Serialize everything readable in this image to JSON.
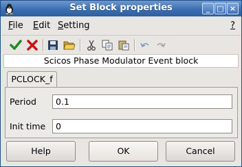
{
  "window": {
    "title": "Set Block properties"
  },
  "menu": {
    "file": {
      "mnemonic": "F",
      "rest": "ile"
    },
    "edit": {
      "mnemonic": "E",
      "rest": "dit"
    },
    "setting": {
      "mnemonic": "S",
      "rest": "etting"
    },
    "help": "?"
  },
  "toolbar": {
    "icons": [
      "check-icon",
      "cross-icon",
      "save-icon",
      "open-folder-icon",
      "cut-icon",
      "copy-icon",
      "paste-icon",
      "undo-icon",
      "redo-icon"
    ]
  },
  "block": {
    "title": "Scicos Phase Modulator Event block"
  },
  "tab": {
    "label": "PCLOCK_f"
  },
  "fields": {
    "period": {
      "label": "Period",
      "value": "0.1"
    },
    "init_time": {
      "label": "Init time",
      "value": "0"
    }
  },
  "buttons": {
    "help": "Help",
    "ok": "OK",
    "cancel": "Cancel"
  },
  "colors": {
    "titlebar": "#3b6fb3",
    "check": "#1f8c1f",
    "cross": "#cc1111"
  }
}
